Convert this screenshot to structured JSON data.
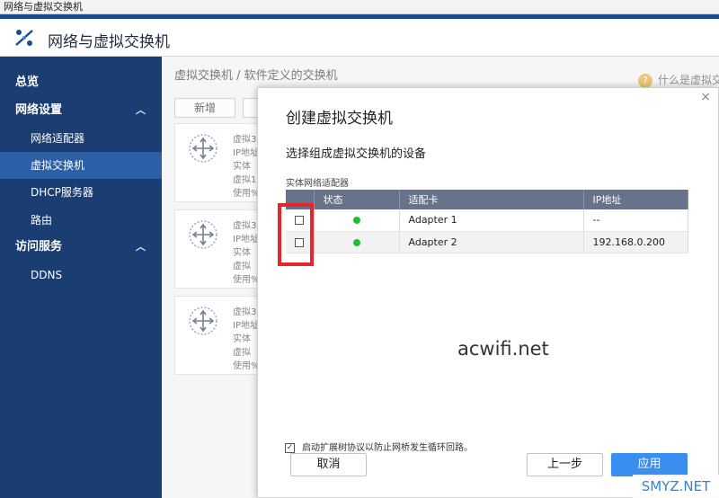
{
  "window": {
    "title": "网络与虚拟交换机"
  },
  "header": {
    "app_title": "网络与虚拟交换机",
    "logo_icon": "network-switch-icon"
  },
  "sidebar": {
    "items": [
      {
        "label": "总览",
        "level": "top",
        "expandable": false,
        "active": false
      },
      {
        "label": "网络设置",
        "level": "top",
        "expandable": true,
        "active": false
      },
      {
        "label": "网络适配器",
        "level": "sub",
        "expandable": false,
        "active": false
      },
      {
        "label": "虚拟交换机",
        "level": "sub",
        "expandable": false,
        "active": true
      },
      {
        "label": "DHCP服务器",
        "level": "sub",
        "expandable": false,
        "active": false
      },
      {
        "label": "路由",
        "level": "sub",
        "expandable": false,
        "active": false
      },
      {
        "label": "访问服务",
        "level": "top",
        "expandable": true,
        "active": false
      },
      {
        "label": "DDNS",
        "level": "sub",
        "expandable": false,
        "active": false
      }
    ],
    "caret": "^"
  },
  "main": {
    "breadcrumb": "虚拟交换机 / 软件定义的交换机",
    "help_link": "什么是虚拟交",
    "add_button": "新增",
    "cards": [
      {
        "lines": [
          "虚拟3",
          "IP地址",
          "实体",
          "虚拟1",
          "使用%"
        ]
      },
      {
        "lines": [
          "虚拟3",
          "IP地址",
          "实体",
          "虚拟",
          "使用%"
        ]
      },
      {
        "lines": [
          "虚拟3",
          "IP地址",
          "实体",
          "虚拟",
          "使用%"
        ]
      }
    ]
  },
  "dialog": {
    "title": "创建虚拟交换机",
    "subtitle": "选择组成虚拟交换机的设备",
    "section_label": "实体网络适配器",
    "table": {
      "headers": [
        "",
        "状态",
        "适配卡",
        "IP地址"
      ],
      "rows": [
        {
          "checked": false,
          "status": "online",
          "adapter": "Adapter 1",
          "ip": "--"
        },
        {
          "checked": false,
          "status": "online",
          "adapter": "Adapter 2",
          "ip": "192.168.0.200"
        }
      ]
    },
    "stp_checkbox": {
      "checked": true,
      "mark": "✓",
      "label": "启动扩展树协议以防止网桥发生循环回路。"
    },
    "buttons": {
      "cancel": "取消",
      "back": "上一步",
      "apply": "应用"
    },
    "close_symbol": "×"
  },
  "watermark": "acwifi.net",
  "corner_mark": "SMYZ.NET",
  "colors": {
    "sidebar": "#1a3d72",
    "sidebar_active": "#2d5fa6",
    "primary": "#3a8ef0",
    "status_online": "#1fbf2f",
    "table_header": "#67738a",
    "highlight": "#e3272a"
  }
}
